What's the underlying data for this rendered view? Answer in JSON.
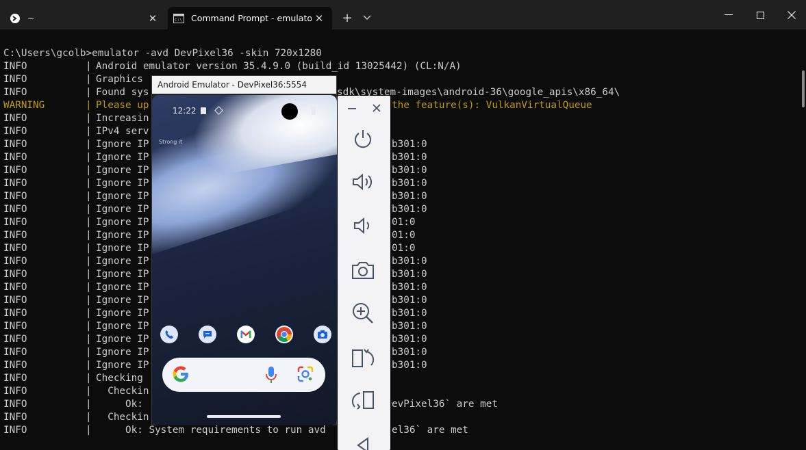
{
  "tabs": [
    {
      "title": "~",
      "icon": "terminal-icon"
    },
    {
      "title": "Command Prompt - emulator",
      "icon": "cmd-icon"
    }
  ],
  "terminal": {
    "command": "C:\\Users\\gcolb>emulator -avd DevPixel36 -skin 720x1280",
    "lines": [
      {
        "level": "INFO",
        "text": "Android emulator version 35.4.9.0 (build_id 13025442) (CL:N/A)"
      },
      {
        "level": "INFO",
        "text": "Graphics"
      },
      {
        "level": "INFO",
        "text": "Found sys"
      },
      {
        "level": "WARNING",
        "text": "Please up"
      },
      {
        "level": "INFO",
        "text": "Increasin"
      },
      {
        "level": "INFO",
        "text": "IPv4 serv"
      },
      {
        "level": "INFO",
        "text": "Ignore IP"
      },
      {
        "level": "INFO",
        "text": "Ignore IP"
      },
      {
        "level": "INFO",
        "text": "Ignore IP"
      },
      {
        "level": "INFO",
        "text": "Ignore IP"
      },
      {
        "level": "INFO",
        "text": "Ignore IP"
      },
      {
        "level": "INFO",
        "text": "Ignore IP"
      },
      {
        "level": "INFO",
        "text": "Ignore IP"
      },
      {
        "level": "INFO",
        "text": "Ignore IP"
      },
      {
        "level": "INFO",
        "text": "Ignore IP"
      },
      {
        "level": "INFO",
        "text": "Ignore IP"
      },
      {
        "level": "INFO",
        "text": "Ignore IP"
      },
      {
        "level": "INFO",
        "text": "Ignore IP"
      },
      {
        "level": "INFO",
        "text": "Ignore IP"
      },
      {
        "level": "INFO",
        "text": "Ignore IP"
      },
      {
        "level": "INFO",
        "text": "Ignore IP"
      },
      {
        "level": "INFO",
        "text": "Ignore IP"
      },
      {
        "level": "INFO",
        "text": "Ignore IP"
      },
      {
        "level": "INFO",
        "text": "Ignore IP"
      },
      {
        "level": "INFO",
        "text": "Checking "
      },
      {
        "level": "INFO",
        "text": "  Checkin"
      },
      {
        "level": "INFO",
        "text": "     Ok:"
      },
      {
        "level": "INFO",
        "text": "  Checkin"
      },
      {
        "level": "INFO",
        "text": "     Ok: System requirements to run avd"
      }
    ],
    "right_fragments": [
      "sdk\\system-images\\android-36\\google_apis\\x86_64\\",
      "the feature(s): VulkanVirtualQueue",
      "b301:0",
      "b301:0",
      "b301:0",
      "b301:0",
      "b301:0",
      "b301:0",
      "01:0",
      "01:0",
      "01:0",
      "b301:0",
      "b301:0",
      "b301:0",
      "b301:0",
      "b301:0",
      "b301:0",
      "b301:0",
      "b301:0",
      "b301:0",
      "evPixel36` are met",
      "el36` are met"
    ]
  },
  "emulator": {
    "window_title": "Android Emulator - DevPixel36:5554",
    "status_time": "12:22",
    "glance_text": "Strong it",
    "dock_apps": [
      "phone-icon",
      "messages-icon",
      "gmail-icon",
      "chrome-icon",
      "camera-app-icon"
    ],
    "toolbar": [
      "power-icon",
      "volume-up-icon",
      "volume-down-icon",
      "screenshot-icon",
      "zoom-icon",
      "rotate-left-icon",
      "rotate-right-icon",
      "back-icon"
    ]
  },
  "colors": {
    "terminal_bg": "#0c0c0c",
    "terminal_text": "#cccccc",
    "warning_text": "#c19c00",
    "titlebar_bg": "#202020"
  }
}
